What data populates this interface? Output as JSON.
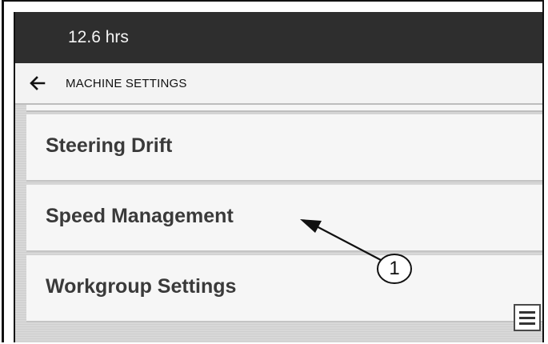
{
  "status_bar": {
    "hours": "12.6 hrs"
  },
  "nav": {
    "back_icon": "arrow-left-icon",
    "title": "MACHINE SETTINGS"
  },
  "menu": {
    "items": [
      {
        "label": "Steering Drift"
      },
      {
        "label": "Speed Management"
      },
      {
        "label": "Workgroup Settings"
      }
    ]
  },
  "menu_button": {
    "icon": "hamburger-menu-icon"
  },
  "callout": {
    "number": "1"
  }
}
